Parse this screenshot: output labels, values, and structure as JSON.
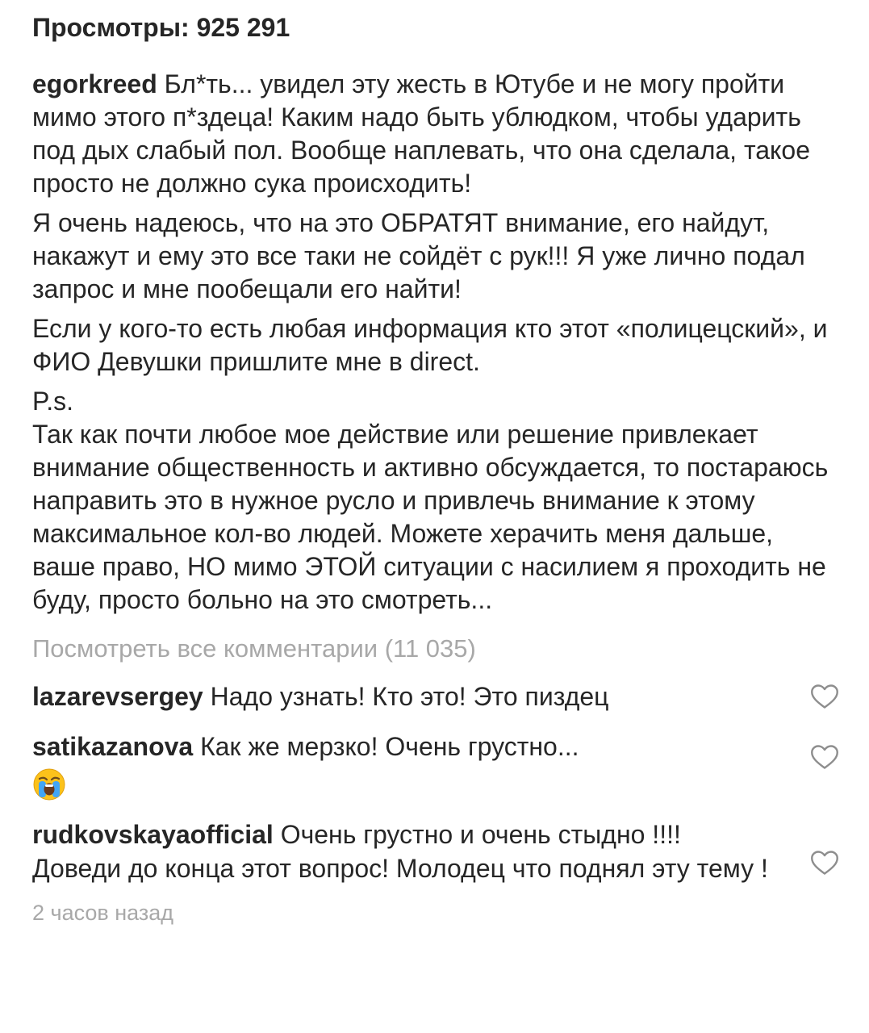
{
  "post": {
    "views": "Просмотры: 925 291",
    "author": "egorkreed",
    "caption_paragraphs": [
      "Бл*ть... увидел эту жесть в Ютубе и не могу пройти мимо этого п*здеца! Каким надо быть ублюдком, чтобы ударить под дых слабый пол. Вообще наплевать, что она сделала, такое просто не должно сука происходить!",
      "Я очень надеюсь, что на это ОБРАТЯТ внимание, его найдут, накажут и ему это все таки не сойдёт с рук!!! Я уже лично подал запрос и мне пообещали его найти!",
      "Если у кого-то есть любая информация кто этот «полицецский», и ФИО Девушки пришлите мне в direct.",
      "P.s.",
      "Так как почти любое мое действие или решение привлекает внимание общественность и активно обсуждается, то постараюсь направить это в нужное русло и привлечь внимание к этому максимальное кол-во людей. Можете херачить меня дальше, ваше право, НО мимо ЭТОЙ ситуации с насилием я проходить не буду, просто больно на это смотреть..."
    ],
    "view_all_comments": "Посмотреть все комментарии (11 035)",
    "time_ago": "2 часов назад"
  },
  "comments": [
    {
      "user": "lazarevsergey",
      "text": "Надо узнать! Кто это! Это пиздец",
      "icon": "heart-outline-icon"
    },
    {
      "user": "satikazanova",
      "text": "Как же мерзко! Очень грустно...",
      "emoji": "crying-face-emoji",
      "icon": "heart-outline-icon"
    },
    {
      "user": "rudkovskayaofficial",
      "text": "Очень грустно и очень стыдно !!!! Доведи до конца этот вопрос! Молодец что поднял эту тему !",
      "icon": "heart-outline-icon"
    }
  ],
  "colors": {
    "text": "#262626",
    "muted": "#a8a8a8",
    "heart_outline": "#8e8e8e"
  }
}
